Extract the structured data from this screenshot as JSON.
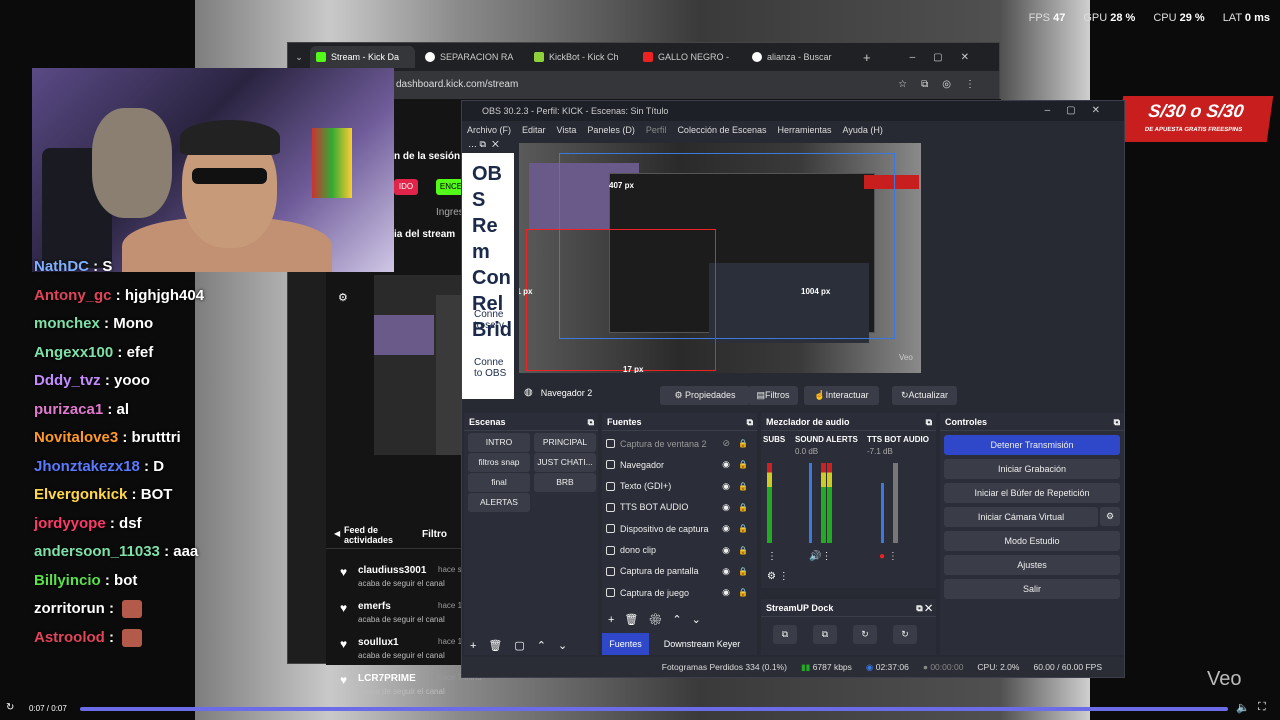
{
  "stats": {
    "fps_label": "FPS",
    "fps": "47",
    "gpu_label": "GPU",
    "gpu": "28 %",
    "cpu_label": "CPU",
    "cpu": "29 %",
    "lat_label": "LAT",
    "lat": "0 ms"
  },
  "chat": [
    {
      "user": "NathDC",
      "color": "#7fb0ff",
      "msg": "S"
    },
    {
      "user": "Antony_gc",
      "color": "#e0455a",
      "msg": "hjghjgh404"
    },
    {
      "user": "monchex",
      "color": "#7fe0a8",
      "msg": "Mono"
    },
    {
      "user": "Angexx100",
      "color": "#7fe0a8",
      "msg": "efef"
    },
    {
      "user": "Dddy_tvz",
      "color": "#c58cff",
      "msg": "yooo"
    },
    {
      "user": "purizaca1",
      "color": "#e07ad0",
      "msg": "al"
    },
    {
      "user": "Novitalove3",
      "color": "#ff9a2a",
      "msg": "brutttri"
    },
    {
      "user": "Jhonztakezx18",
      "color": "#5a7aff",
      "msg": "D"
    },
    {
      "user": "Elvergonkick",
      "color": "#ffd84a",
      "msg": "BOT"
    },
    {
      "user": "jordyyope",
      "color": "#ff3a6a",
      "msg": "dsf"
    },
    {
      "user": "andersoon_11033",
      "color": "#7fe0a8",
      "msg": "aaa"
    },
    {
      "user": "Billyincio",
      "color": "#59e04a",
      "msg": "bot"
    },
    {
      "user": "zorritorun",
      "color": "#ffffff",
      "msg": ""
    },
    {
      "user": "Astroolod",
      "color": "#e0455a",
      "msg": ""
    }
  ],
  "browser": {
    "tabs": [
      "Stream - Kick Da",
      "SEPARACION RA",
      "KickBot - Kick Ch",
      "GALLO NEGRO -",
      "alianza - Buscar"
    ],
    "url": "dashboard.kick.com/stream",
    "session": "n de la sesión",
    "btn_red": "IDO",
    "btn_green": "ENCE",
    "ingres": "Ingres",
    "stream_info": "ia del stream",
    "feed_title": "Feed de actividades",
    "filter": "Filtro",
    "feed": [
      {
        "name": "claudiuss3001",
        "time": "hace segund",
        "sub": "acaba de seguir el canal"
      },
      {
        "name": "emerfs",
        "time": "hace 1 minu",
        "sub": "acaba de seguir el canal"
      },
      {
        "name": "soullux1",
        "time": "hace 1 minu",
        "sub": "acaba de seguir el canal"
      },
      {
        "name": "LCR7PRIME",
        "time": "hace 7 minu",
        "sub": "acaba de seguir el canal"
      }
    ]
  },
  "promo": {
    "line1": "S/30 o S/30",
    "line2": "DE APUESTA GRATIS     FREESPINS"
  },
  "obs": {
    "title": "OBS 30.2.3 - Perfil: KICK - Escenas: Sin Título",
    "menu": [
      "Archivo (F)",
      "Editar",
      "Vista",
      "Paneles (D)",
      "Perfil",
      "Colección de Escenas",
      "Herramientas",
      "Ayuda (H)"
    ],
    "side_text": "OBS Rem Con Rel Brid",
    "side_connect1": "Conne to serv",
    "side_connect2": "Conne to OBS",
    "source_name": "Navegador 2",
    "preview_labels": {
      "top": "407 px",
      "left": "41 px",
      "right": "1004 px",
      "bottom": "17 px",
      "veo": "Veo"
    },
    "buttons": [
      "Propiedades",
      "Filtros",
      "Interactuar",
      "Actualizar"
    ],
    "scenes_title": "Escenas",
    "scenes": [
      "INTRO",
      "PRINCIPAL",
      "filtros snap",
      "JUST CHATI...",
      "final",
      "BRB",
      "ALERTAS"
    ],
    "sources_title": "Fuentes",
    "sources": [
      "Captura de ventana 2",
      "Navegador",
      "Texto (GDI+)",
      "TTS BOT AUDIO",
      "Dispositivo de captura",
      "dono clip",
      "Captura de pantalla",
      "Captura de juego"
    ],
    "mixer_title": "Mezclador de audio",
    "mixer": [
      {
        "name": "SUBS",
        "db": ""
      },
      {
        "name": "SOUND ALERTS",
        "db": "0.0 dB"
      },
      {
        "name": "TTS BOT AUDIO",
        "db": "-7.1 dB"
      }
    ],
    "controls_title": "Controles",
    "controls": [
      "Detener Transmisión",
      "Iniciar Grabación",
      "Iniciar el Búfer de Repetición",
      "Iniciar Cámara Virtual",
      "Modo Estudio",
      "Ajustes",
      "Salir"
    ],
    "dock_title": "StreamUP Dock",
    "bottom_tabs": [
      "Fuentes",
      "Downstream Keyer"
    ],
    "status": {
      "frames": "Fotogramas Perdidos 334 (0.1%)",
      "kbps": "6787 kbps",
      "time_live": "02:37:06",
      "time_rec": "00:00:00",
      "cpu": "CPU: 2.0%",
      "fps": "60.00 / 60.00 FPS"
    }
  },
  "player": {
    "time": "0:07 / 0:07",
    "progress": 1.0,
    "watermark": "Veo"
  }
}
